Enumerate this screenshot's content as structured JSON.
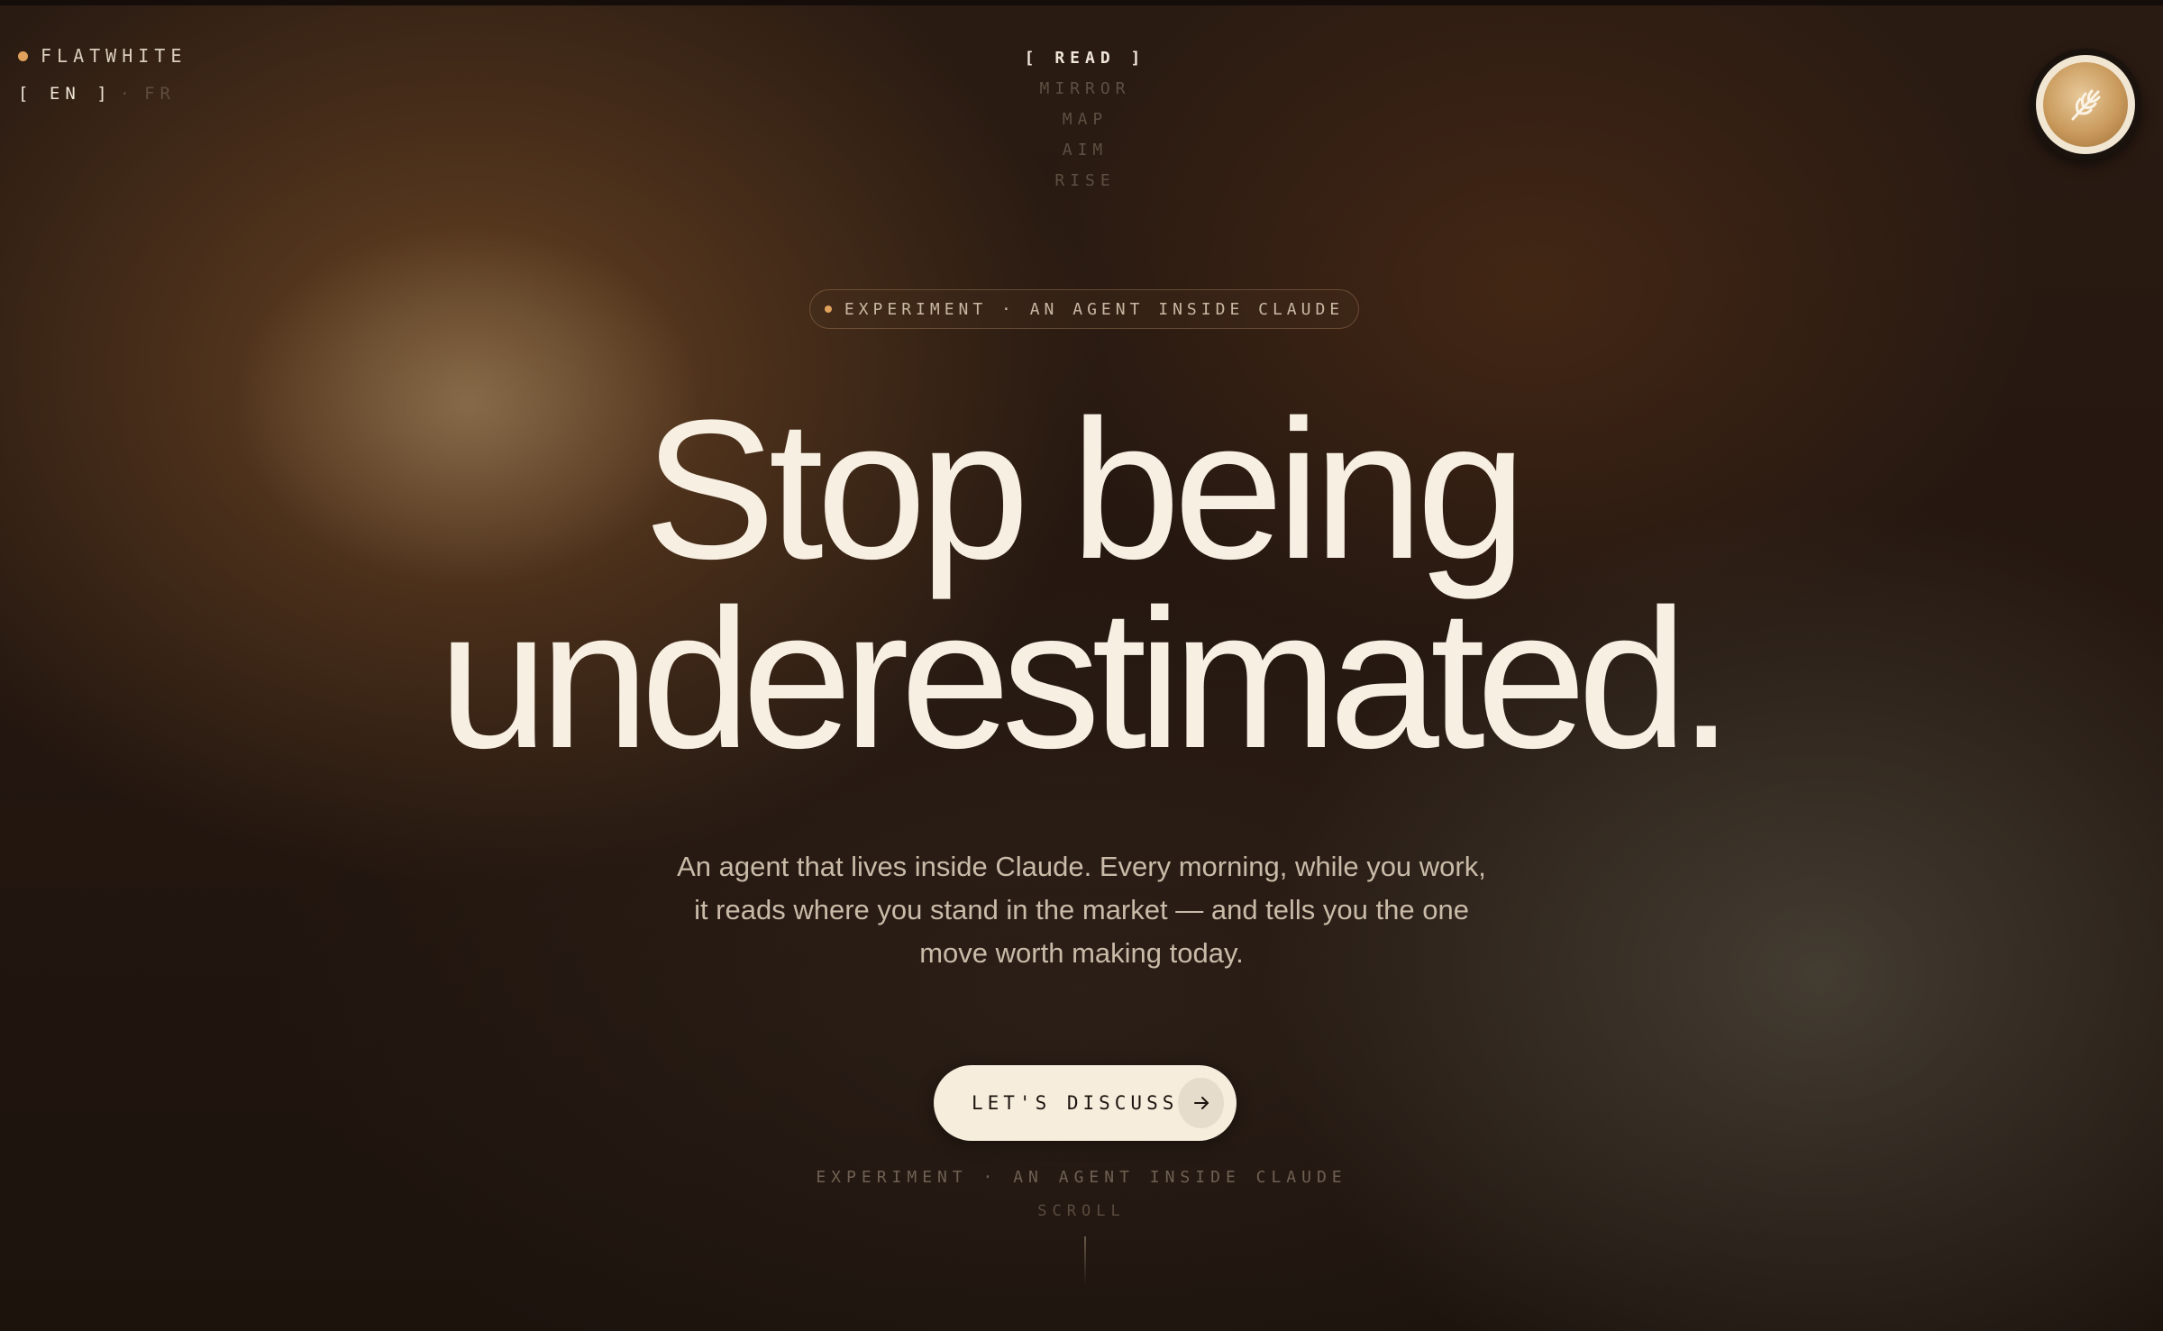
{
  "brand": {
    "name": "FLATWHITE"
  },
  "language": {
    "active": "[ EN ]",
    "separator": "·",
    "other": "FR"
  },
  "nav": {
    "items": [
      {
        "label": "[ READ ]",
        "active": true
      },
      {
        "label": "MIRROR",
        "active": false
      },
      {
        "label": "MAP",
        "active": false
      },
      {
        "label": "AIM",
        "active": false
      },
      {
        "label": "RISE",
        "active": false
      }
    ]
  },
  "hero": {
    "badge": "EXPERIMENT · AN AGENT INSIDE CLAUDE",
    "headline_line1": "Stop being",
    "headline_line2": "underestimated.",
    "description": "An agent that lives inside Claude. Every morning, while you work, it reads where you stand in the market — and tells you the one move worth making today.",
    "cta_label": "LET'S DISCUSS",
    "cta_icon": "arrow-right-icon"
  },
  "footer": {
    "tagline": "EXPERIMENT · AN AGENT INSIDE CLAUDE",
    "scroll_label": "SCROLL"
  },
  "colors": {
    "accent": "#e0a25c",
    "text_primary": "#f7efe2",
    "background": "#1e140e",
    "button_bg": "#f6eddd"
  },
  "icons": {
    "cup": "flat-white-cup-icon"
  }
}
